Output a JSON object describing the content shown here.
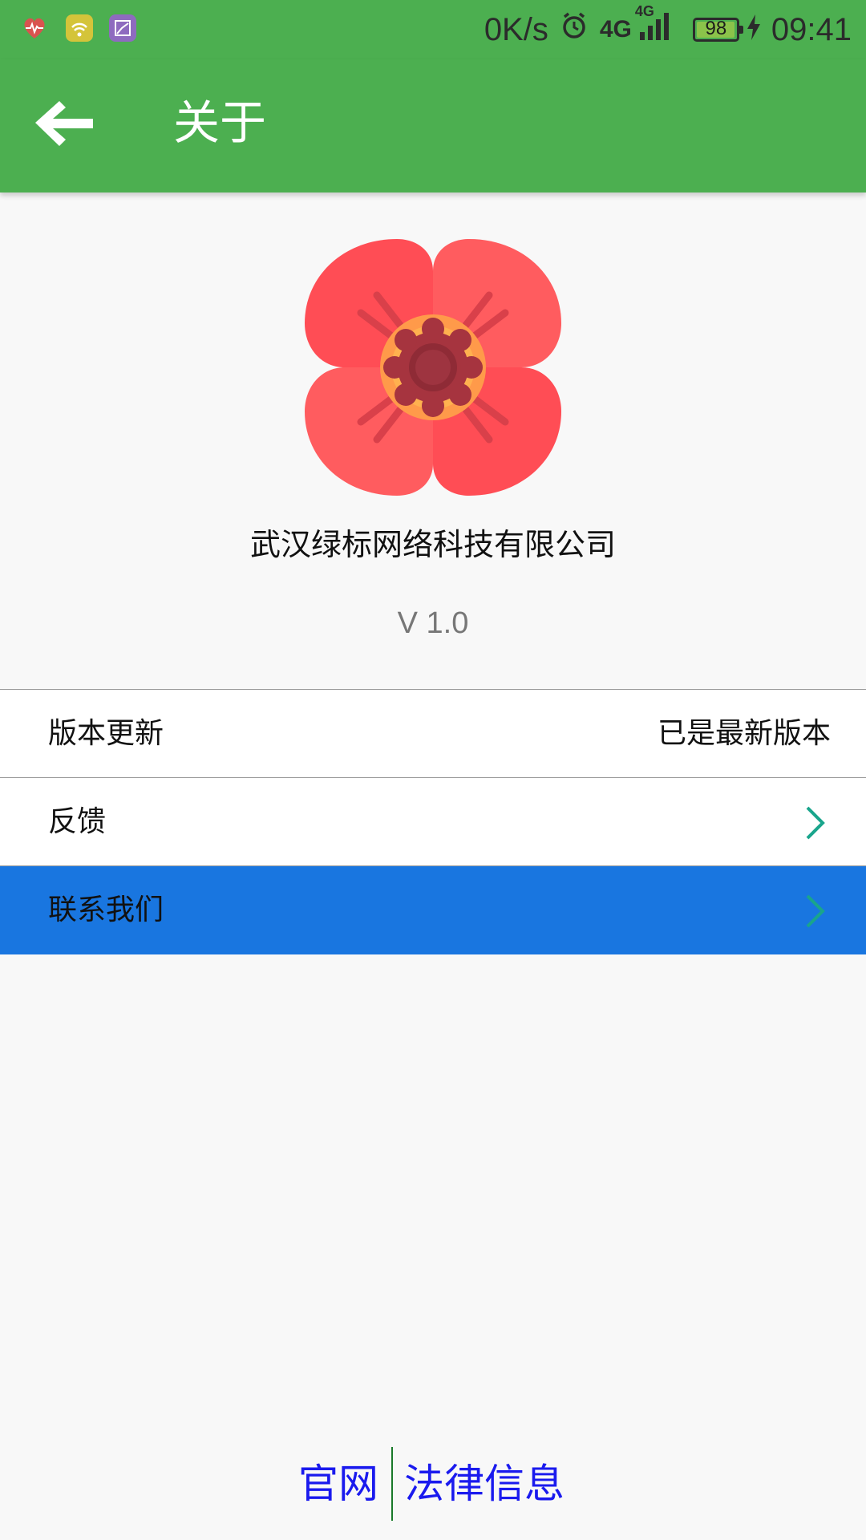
{
  "colors": {
    "primary": "#4caf50",
    "highlight_row": "#1976e0",
    "chevron": "#19a58c",
    "footer_link": "#1a1aee",
    "version_text": "#777777"
  },
  "status_bar": {
    "app_icons": [
      "heart-rate-icon",
      "wifi-hotspot-icon",
      "image-icon"
    ],
    "net_speed": "0K/s",
    "network_1": "4G",
    "network_2": "4G",
    "battery_level": "98",
    "battery_fraction": 0.98,
    "time": "09:41"
  },
  "toolbar": {
    "back_icon": "arrow-left-icon",
    "title": "关于"
  },
  "header": {
    "logo_icon": "poppy-flower-icon",
    "company_name": "武汉绿标网络科技有限公司",
    "version": "V 1.0"
  },
  "list": {
    "items": [
      {
        "label": "版本更新",
        "value": "已是最新版本"
      },
      {
        "label": "反馈",
        "icon": "chevron-right-icon"
      },
      {
        "label": "联系我们",
        "icon": "chevron-right-icon",
        "highlighted": true
      }
    ]
  },
  "footer": {
    "official_site": "官网",
    "legal_info": "法律信息"
  }
}
